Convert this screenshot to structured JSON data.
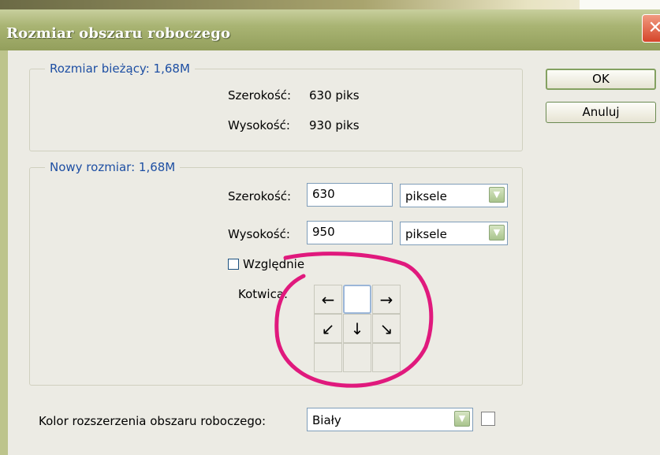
{
  "window": {
    "title": "Rozmiar obszaru roboczego"
  },
  "current_size": {
    "legend": "Rozmiar bieżący: 1,68M",
    "width_label": "Szerokość:",
    "width_value": "630 piks",
    "height_label": "Wysokość:",
    "height_value": "930 piks"
  },
  "new_size": {
    "legend": "Nowy rozmiar: 1,68M",
    "width_label": "Szerokość:",
    "width_value": "630",
    "width_unit": "piksele",
    "height_label": "Wysokość:",
    "height_value": "950",
    "height_unit": "piksele",
    "relative_label": "Względnie",
    "relative_checked": false,
    "anchor_label": "Kotwica:"
  },
  "buttons": {
    "ok": "OK",
    "cancel": "Anuluj"
  },
  "extension_color": {
    "label": "Kolor rozszerzenia obszaru roboczego:",
    "value": "Biały",
    "swatch_color": "#ffffff"
  },
  "annotation": {
    "color": "#e0197d"
  }
}
